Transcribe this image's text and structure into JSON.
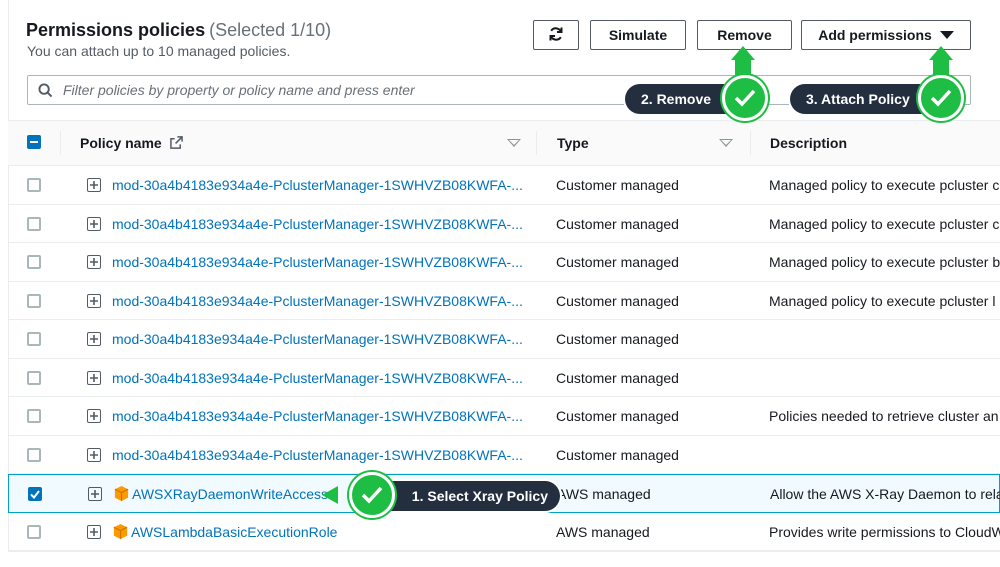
{
  "header": {
    "title": "Permissions policies",
    "count": "(Selected 1/10)",
    "subtitle": "You can attach up to 10 managed policies."
  },
  "toolbar": {
    "refresh_icon": "refresh-icon",
    "simulate_label": "Simulate",
    "remove_label": "Remove",
    "add_label": "Add permissions"
  },
  "search": {
    "placeholder": "Filter policies by property or policy name and press enter"
  },
  "columns": {
    "name": "Policy name",
    "type": "Type",
    "description": "Description"
  },
  "rows": [
    {
      "name": "mod-30a4b4183e934a4e-PclusterManager-1SWHVZB08KWFA-...",
      "type": "Customer managed",
      "description": "Managed policy to execute pcluster c",
      "checked": false,
      "aws": false
    },
    {
      "name": "mod-30a4b4183e934a4e-PclusterManager-1SWHVZB08KWFA-...",
      "type": "Customer managed",
      "description": "Managed policy to execute pcluster c",
      "checked": false,
      "aws": false
    },
    {
      "name": "mod-30a4b4183e934a4e-PclusterManager-1SWHVZB08KWFA-...",
      "type": "Customer managed",
      "description": "Managed policy to execute pcluster b",
      "checked": false,
      "aws": false
    },
    {
      "name": "mod-30a4b4183e934a4e-PclusterManager-1SWHVZB08KWFA-...",
      "type": "Customer managed",
      "description": "Managed policy to execute pcluster l",
      "checked": false,
      "aws": false
    },
    {
      "name": "mod-30a4b4183e934a4e-PclusterManager-1SWHVZB08KWFA-...",
      "type": "Customer managed",
      "description": "",
      "checked": false,
      "aws": false
    },
    {
      "name": "mod-30a4b4183e934a4e-PclusterManager-1SWHVZB08KWFA-...",
      "type": "Customer managed",
      "description": "",
      "checked": false,
      "aws": false
    },
    {
      "name": "mod-30a4b4183e934a4e-PclusterManager-1SWHVZB08KWFA-...",
      "type": "Customer managed",
      "description": "Policies needed to retrieve cluster an",
      "checked": false,
      "aws": false
    },
    {
      "name": "mod-30a4b4183e934a4e-PclusterManager-1SWHVZB08KWFA-...",
      "type": "Customer managed",
      "description": "",
      "checked": false,
      "aws": false
    },
    {
      "name": "AWSXRayDaemonWriteAccess",
      "type": "AWS managed",
      "description": "Allow the AWS X-Ray Daemon to rela",
      "checked": true,
      "aws": true
    },
    {
      "name": "AWSLambdaBasicExecutionRole",
      "type": "AWS managed",
      "description": "Provides write permissions to CloudW",
      "checked": false,
      "aws": true
    }
  ],
  "annotations": {
    "step1": "1. Select Xray Policy",
    "step2": "2. Remove",
    "step3": "3. Attach Policy"
  },
  "colors": {
    "link": "#0073bb",
    "accent_green": "#1ebe45",
    "callout_bg": "#232f3e"
  }
}
